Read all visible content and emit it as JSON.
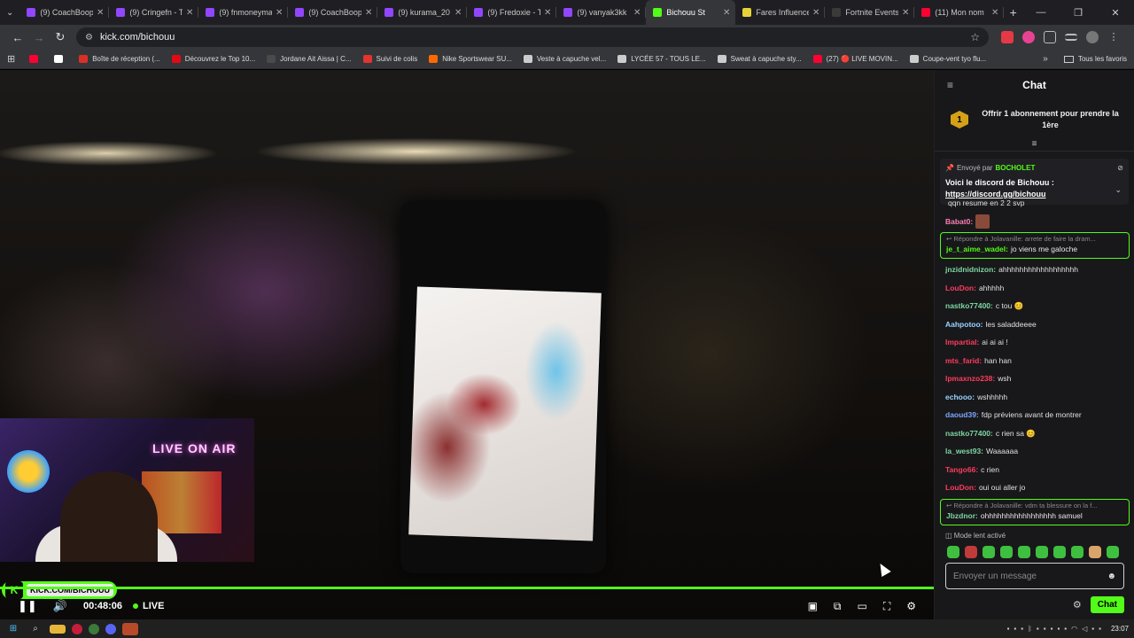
{
  "browser": {
    "tabs": [
      {
        "label": "(9) CoachBoop",
        "favicon_color": "#9146ff",
        "active": false
      },
      {
        "label": "(9) Cringefn - T",
        "favicon_color": "#9146ff",
        "active": false
      },
      {
        "label": "(9) fnmoneyma",
        "favicon_color": "#9146ff",
        "active": false
      },
      {
        "label": "(9) CoachBoop",
        "favicon_color": "#9146ff",
        "active": false
      },
      {
        "label": "(9) kurama_20",
        "favicon_color": "#9146ff",
        "active": false
      },
      {
        "label": "(9) Fredoxie - T",
        "favicon_color": "#9146ff",
        "active": false
      },
      {
        "label": "(9) vanyak3kk",
        "favicon_color": "#9146ff",
        "active": false
      },
      {
        "label": "Bichouu St",
        "favicon_color": "#53fc18",
        "active": true
      },
      {
        "label": "Fares Influence",
        "favicon_color": "#e6d33a",
        "active": false
      },
      {
        "label": "Fortnite Events",
        "favicon_color": "#3a3a3a",
        "active": false
      },
      {
        "label": "(11) Mon nom",
        "favicon_color": "#ff0033",
        "active": false
      }
    ],
    "url": "kick.com/bichouu",
    "bookmarks": [
      {
        "label": "",
        "color": "#ff0033"
      },
      {
        "label": "",
        "color": "#ffffff"
      },
      {
        "label": "Boîte de réception (...",
        "color": "#d93025"
      },
      {
        "label": "Découvrez le Top 10...",
        "color": "#e50914"
      },
      {
        "label": "Jordane Ait Aissa | C...",
        "color": "#4a4a4a"
      },
      {
        "label": "Suivi de colis",
        "color": "#e3342f"
      },
      {
        "label": "Nike Sportswear SU...",
        "color": "#ff6a00"
      },
      {
        "label": "Veste à capuche vel...",
        "color": "#cccccc"
      },
      {
        "label": "LYCÉE 57 - TOUS LE...",
        "color": "#cccccc"
      },
      {
        "label": "Sweat à capuche sty...",
        "color": "#cccccc"
      },
      {
        "label": "(27) 🔴 LIVE MOVIN...",
        "color": "#ff0033"
      },
      {
        "label": "Coupe-vent tyo flu...",
        "color": "#cccccc"
      }
    ],
    "bookmarks_all": "Tous les favoris"
  },
  "player": {
    "watermark": "KICK.COM/BICHOUU",
    "webcam_sign": "LIVE ON AIR",
    "time": "00:48:06",
    "live_label": "LIVE"
  },
  "chat": {
    "title": "Chat",
    "sub_gift_count": "1",
    "sub_gift_text": "Offrir 1 abonnement pour prendre la 1ère",
    "pinned": {
      "sent_by_label": "Envoyé par",
      "sent_by_user": "BOCHOLET",
      "message": "Voici le discord de Bichouu :",
      "link": "https://discord.gg/bichouu"
    },
    "messages": [
      {
        "user": "",
        "color": "#e0e0e0",
        "text": "qqn resume en 2 2 svp"
      },
      {
        "user": "Babat0:",
        "color": "#ff7eb3",
        "text": "",
        "emote": true
      },
      {
        "reply_to": "Répondre à Jolavanille: arrete de faire la dram...",
        "user": "je_t_aime_wadel:",
        "color": "#53fc18",
        "text": "jo viens me galoche"
      },
      {
        "user": "jnzidnidnizon:",
        "color": "#7ed6a0",
        "text": "ahhhhhhhhhhhhhhhhhh"
      },
      {
        "user": "LouDon:",
        "color": "#ff3b5c",
        "text": "ahhhhh"
      },
      {
        "user": "nastko77400:",
        "color": "#7ed6a0",
        "text": "c tou 😊"
      },
      {
        "user": "Aahpotoo:",
        "color": "#9ad3ff",
        "text": "les saladdeeee"
      },
      {
        "user": "Impartial:",
        "color": "#ff3b5c",
        "text": "ai ai ai !"
      },
      {
        "user": "mts_farid:",
        "color": "#ff3b5c",
        "text": "han han"
      },
      {
        "user": "lpmaxnzo238:",
        "color": "#ff3b5c",
        "text": "wsh"
      },
      {
        "user": "echooo:",
        "color": "#9ad3ff",
        "text": "wshhhhh"
      },
      {
        "user": "daoud39:",
        "color": "#7ea6ff",
        "text": "fdp préviens avant de montrer"
      },
      {
        "user": "nastko77400:",
        "color": "#7ed6a0",
        "text": "c rien sa 😊"
      },
      {
        "user": "la_west93:",
        "color": "#7ed6a0",
        "text": "Waaaaaa"
      },
      {
        "user": "Tango66:",
        "color": "#ff3b5c",
        "text": "c rien"
      },
      {
        "user": "LouDon:",
        "color": "#ff3b5c",
        "text": "oui oui aller jo"
      },
      {
        "reply_to": "Répondre à Jolavanille: vdm ta blessure on la f...",
        "user": "Jbzdnor:",
        "color": "#7ed6a0",
        "text": "ohhhhhhhhhhhhhhhhh samuel"
      }
    ],
    "slow_mode": "Mode lent activé",
    "input_placeholder": "Envoyer un message",
    "send_label": "Chat"
  },
  "taskbar": {
    "clock": "23:07"
  }
}
